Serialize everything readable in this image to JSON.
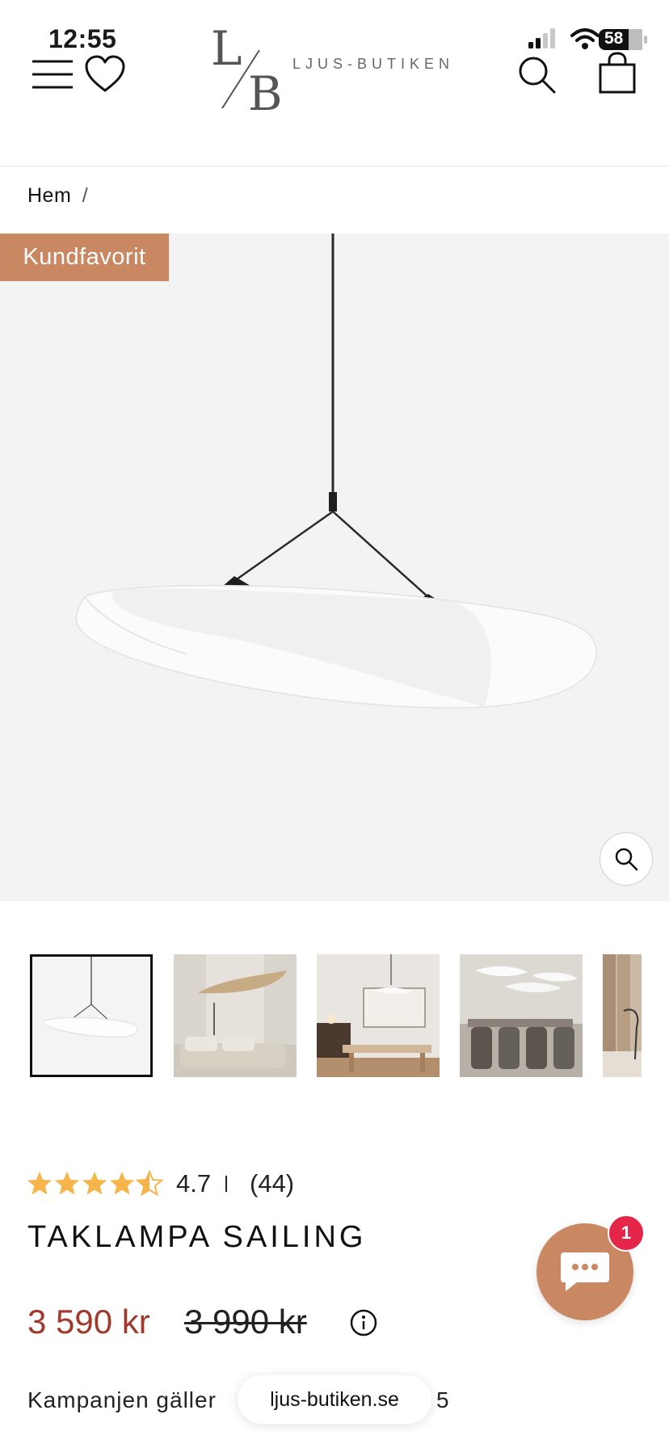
{
  "status_bar": {
    "time": "12:55",
    "battery": "58"
  },
  "header": {
    "logo_monogram_top": "L",
    "logo_monogram_bottom": "B",
    "logo_wordmark": "LJUS-BUTIKEN"
  },
  "breadcrumb": {
    "home": "Hem",
    "separator": "/"
  },
  "product": {
    "badge": "Kundfavorit",
    "rating": {
      "value": "4.7",
      "count": "(44)",
      "stars": 4.5
    },
    "title": "TAKLAMPA SAILING",
    "price_sale": "3 590 kr",
    "price_original": "3 990 kr",
    "campaign_text": "Kampanjen gäller",
    "campaign_end": "5"
  },
  "thumbnails": [
    {
      "name": "thumb-pendant-white",
      "active": true
    },
    {
      "name": "thumb-living-room",
      "active": false
    },
    {
      "name": "thumb-dining-room",
      "active": false
    },
    {
      "name": "thumb-dining-set",
      "active": false
    },
    {
      "name": "thumb-partial",
      "active": false
    }
  ],
  "browser": {
    "url": "ljus-butiken.se"
  },
  "chat": {
    "unread_count": "1"
  },
  "colors": {
    "badge": "#c98762",
    "sale_price": "#a13a2d",
    "star": "#f5b54a",
    "chat_badge": "#e5264a"
  },
  "icons": [
    "menu-icon",
    "heart-icon",
    "search-icon",
    "bag-icon",
    "zoom-icon",
    "info-icon",
    "chat-icon",
    "star-icon"
  ]
}
